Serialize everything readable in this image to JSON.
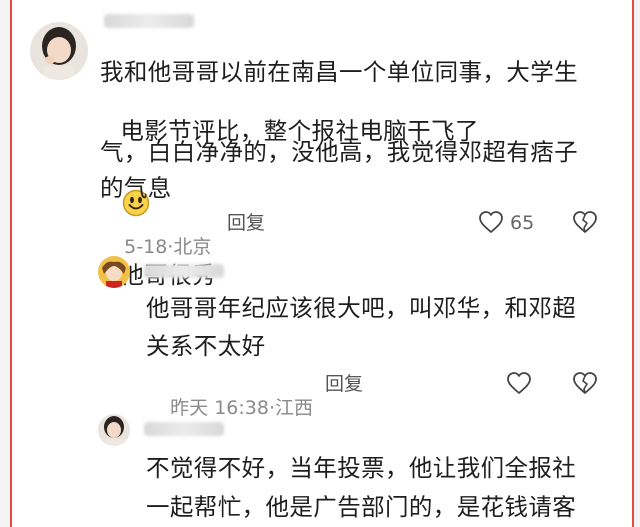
{
  "comments": [
    {
      "lines": [
        "我和他哥哥以前在南昌一个单位同事，大学生",
        "电影节评比，整个报社电脑干飞了",
        "他哥很秀",
        "气，白白净净的，没他高，我觉得邓超有痞子",
        "的气息"
      ],
      "date": "5-18",
      "location": "北京",
      "reply_label": "回复",
      "like_count": "65",
      "emoji_icon": "smiling-face-icon"
    },
    {
      "lines": [
        "他哥哥年纪应该很大吧，叫邓华，和邓超",
        "关系不太好"
      ],
      "date": "昨天 16:38",
      "location": "江西",
      "reply_label": "回复"
    },
    {
      "lines": [
        "不觉得不好，当年投票，他让我们全报社",
        "一起帮忙，他是广告部门的，是花钱请客"
      ]
    }
  ],
  "separator": "·",
  "colors": {
    "border": "#e54a3c",
    "text": "#1e1e1e",
    "meta": "#8a8a8a"
  }
}
